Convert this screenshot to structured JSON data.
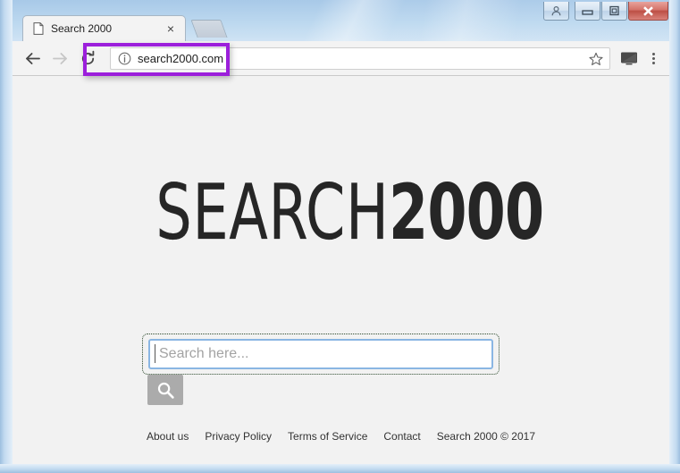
{
  "window": {
    "controls": {
      "user_label": "user-account",
      "minimize_label": "Minimize",
      "maximize_label": "Maximize",
      "close_label": "Close"
    }
  },
  "browser": {
    "tab": {
      "title": "Search 2000",
      "close_label": "×",
      "page_icon": "page-icon"
    },
    "new_tab_label": "New tab",
    "nav": {
      "back_label": "Back",
      "forward_label": "Forward",
      "reload_label": "Reload"
    },
    "omnibox": {
      "url": "search2000.com",
      "info_icon": "info-icon",
      "star_icon": "star-icon"
    },
    "cast_icon": "cast-icon",
    "menu_icon": "three-dot-menu-icon",
    "highlight_color": "#9c1fdb"
  },
  "page": {
    "logo": {
      "light_part": "SEARCH",
      "bold_part": "2000",
      "color": "#262626"
    },
    "search": {
      "placeholder": "Search here...",
      "value": "",
      "submit_icon": "search-icon",
      "submit_color": "#ababab",
      "input_border_color": "#8ab6e3",
      "focus_ring_color": "#2d4a2d"
    },
    "footer": {
      "links": [
        {
          "label": "About us"
        },
        {
          "label": "Privacy Policy"
        },
        {
          "label": "Terms of Service"
        },
        {
          "label": "Contact"
        }
      ],
      "copyright": "Search 2000 © 2017"
    },
    "background_color": "#f2f2f2"
  }
}
